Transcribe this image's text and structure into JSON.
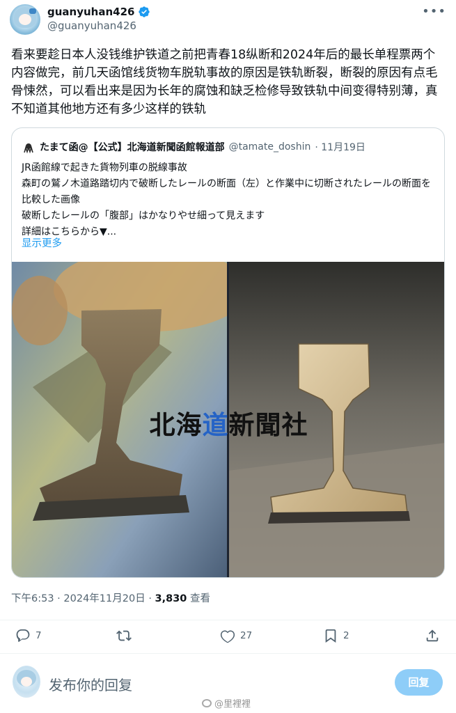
{
  "author": {
    "display_name": "guanyuhan426",
    "handle": "@guanyuhan426"
  },
  "tweet": {
    "text": "看来要趁日本人没钱维护铁道之前把青春18纵断和2024年后的最长单程票两个内容做完，前几天函馆线货物车脱轨事故的原因是铁轨断裂，断裂的原因有点毛骨悚然，可以看出来是因为长年的腐蚀和缺乏检修导致铁轨中间变得特别薄，真不知道其他地方还有多少这样的铁轨"
  },
  "quote": {
    "name": "たまて函@【公式】北海道新聞函館報道部",
    "handle": "@tamate_doshin",
    "date": "· 11月19日",
    "lines": [
      "JR函館線で起きた貨物列車の脱線事故",
      "森町の鷲ノ木道路踏切内で破断したレールの断面（左）と作業中に切断されたレールの断面を比較した画像",
      "破断したレールの「腹部」はかなりやせ細って見えます",
      "詳細はこちらから▼..."
    ],
    "show_more": "显示更多",
    "image_watermark": {
      "part1": "北海",
      "part2": "道",
      "part3": "新聞社"
    }
  },
  "meta": {
    "time": "下午6:53",
    "date": "2024年11月20日",
    "views": "3,830",
    "views_label": "查看"
  },
  "actions": {
    "reply_count": "7",
    "retweet_count": "",
    "like_count": "27",
    "bookmark_count": "2"
  },
  "composer": {
    "placeholder": "发布你的回复",
    "button": "回复"
  },
  "watermark_credit": "@里裡裡",
  "colors": {
    "accent": "#1d9bf0",
    "reply_button": "#8ecdf8",
    "muted": "#536471"
  }
}
